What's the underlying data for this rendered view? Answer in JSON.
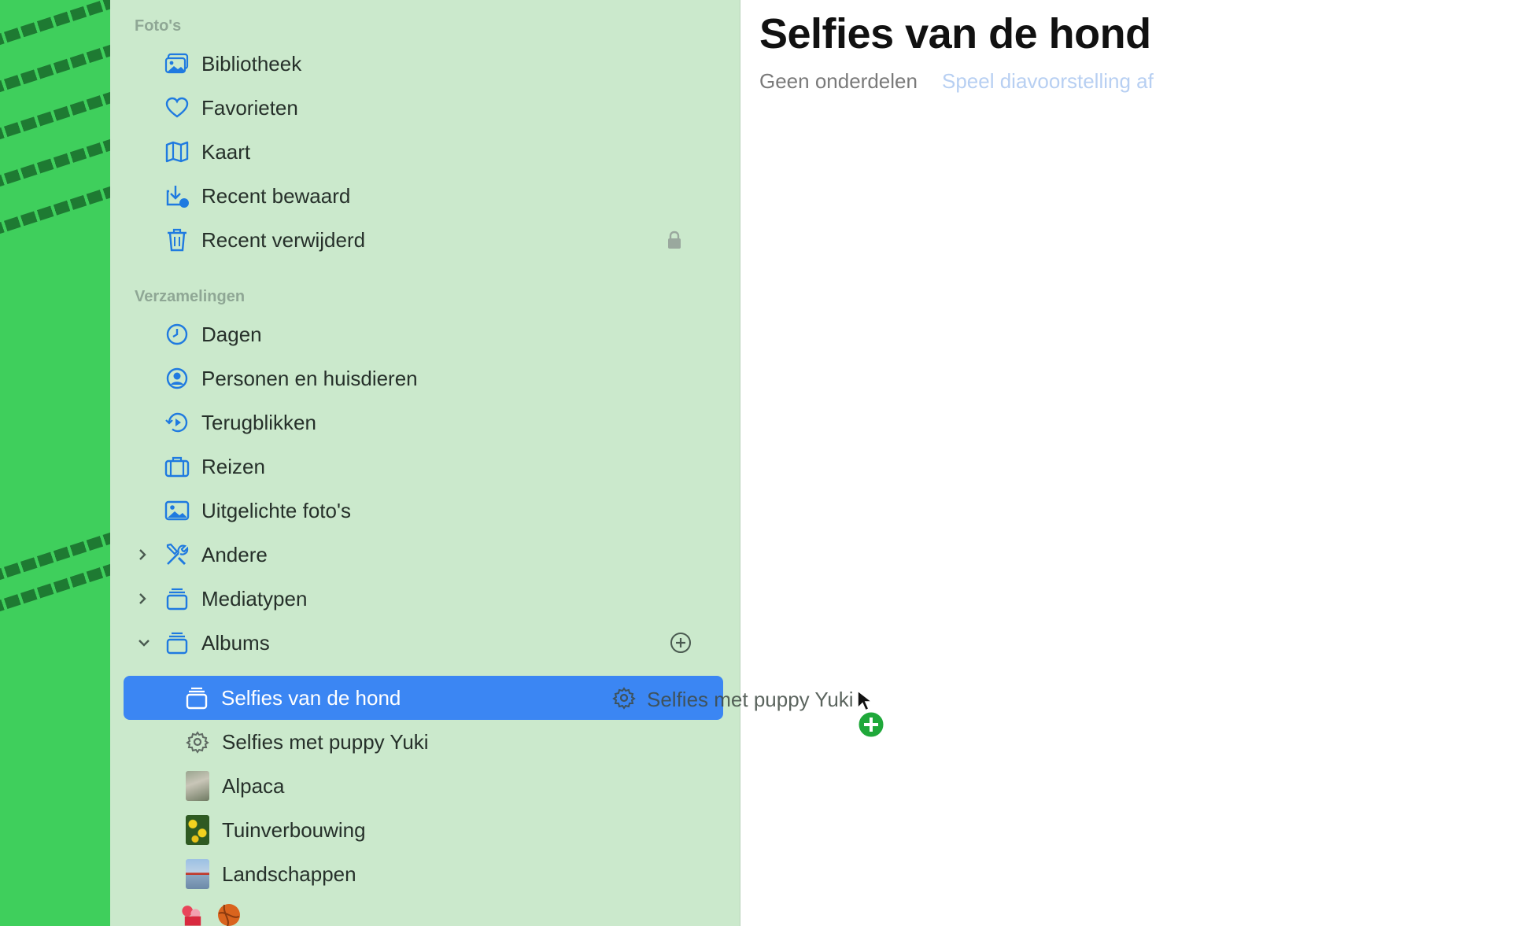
{
  "sidebar": {
    "section_photos": "Foto's",
    "photos_items": [
      {
        "label": "Bibliotheek",
        "icon": "library-icon"
      },
      {
        "label": "Favorieten",
        "icon": "heart-icon"
      },
      {
        "label": "Kaart",
        "icon": "map-icon"
      },
      {
        "label": "Recent bewaard",
        "icon": "download-icon"
      },
      {
        "label": "Recent verwijderd",
        "icon": "trash-icon"
      }
    ],
    "section_collections": "Verzamelingen",
    "collection_items": [
      {
        "label": "Dagen",
        "icon": "clock-icon"
      },
      {
        "label": "Personen en huisdieren",
        "icon": "person-circle-icon"
      },
      {
        "label": "Terugblikken",
        "icon": "memories-icon"
      },
      {
        "label": "Reizen",
        "icon": "suitcase-icon"
      },
      {
        "label": "Uitgelichte foto's",
        "icon": "photo-icon"
      },
      {
        "label": "Andere",
        "icon": "tools-icon"
      },
      {
        "label": "Mediatypen",
        "icon": "stack-icon"
      },
      {
        "label": "Albums",
        "icon": "stack-icon"
      }
    ],
    "album_items": [
      {
        "label": "Selfies van de hond",
        "icon": "album-stack-icon",
        "selected": true
      },
      {
        "label": "Selfies met puppy Yuki",
        "icon": "smart-album-gear-icon"
      },
      {
        "label": "Alpaca",
        "icon": "alpaca-thumbnail"
      },
      {
        "label": "Tuinverbouwing",
        "icon": "garden-thumbnail"
      },
      {
        "label": "Landschappen",
        "icon": "landscape-thumbnail"
      }
    ]
  },
  "main": {
    "title": "Selfies van de hond",
    "item_count": "Geen onderdelen",
    "slideshow_link": "Speel diavoorstelling af"
  },
  "drag": {
    "label": "Selfies met puppy Yuki"
  },
  "colors": {
    "accent": "#3b86f3",
    "sidebar_bg": "#cbe9cc",
    "icon_blue": "#1f7ae0",
    "desktop_green": "#3fcf5c"
  }
}
